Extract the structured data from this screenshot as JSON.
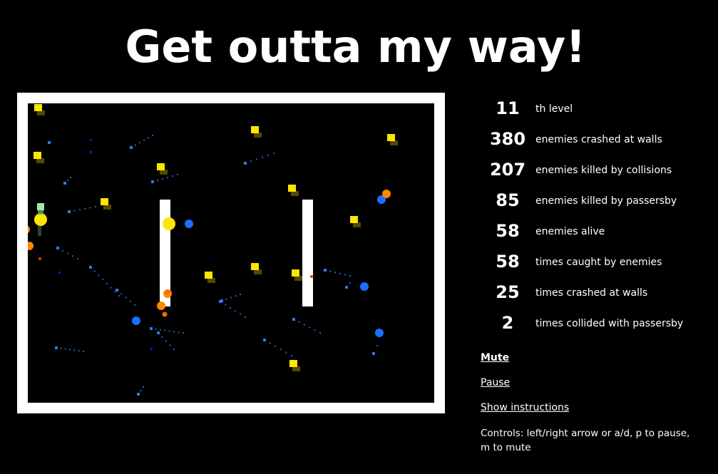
{
  "title": "Get outta my way!",
  "stats": [
    {
      "value": "11",
      "label": "th level"
    },
    {
      "value": "380",
      "label": "enemies crashed at walls"
    },
    {
      "value": "207",
      "label": "enemies killed by collisions"
    },
    {
      "value": "85",
      "label": "enemies killed by passersby"
    },
    {
      "value": "58",
      "label": "enemies alive"
    },
    {
      "value": "58",
      "label": "times caught by enemies"
    },
    {
      "value": "25",
      "label": "times crashed at walls"
    },
    {
      "value": "2",
      "label": "times collided with passersby"
    }
  ],
  "links": {
    "mute": "Mute",
    "pause": "Pause",
    "instructions": "Show instructions"
  },
  "controls_text": "Controls: left/right arrow or a/d, p to pause, m to mute",
  "colors": {
    "background": "#000000",
    "wall": "#ffffff",
    "yellow": "#ffe600",
    "orange": "#ff8800",
    "blue": "#1a6fff",
    "red": "#ff3300"
  }
}
